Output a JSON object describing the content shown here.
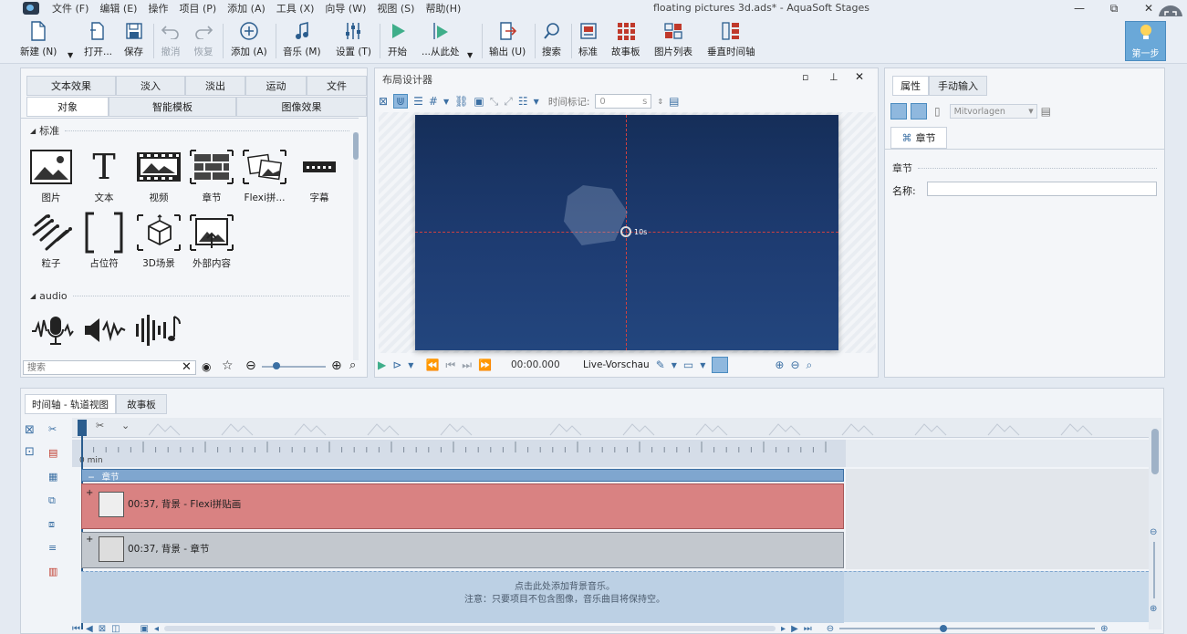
{
  "window": {
    "title": "floating pictures 3d.ads* - AquaSoft Stages",
    "min": "—",
    "restore": "⧉",
    "close": "✕"
  },
  "menu": [
    "文件 (F)",
    "编辑 (E)",
    "操作",
    "项目 (P)",
    "添加 (A)",
    "工具 (X)",
    "向导 (W)",
    "视图 (S)",
    "帮助(H)"
  ],
  "toolbar": {
    "new": "新建 (N)",
    "open": "打开...",
    "save": "保存",
    "undo": "撤消",
    "redo": "恢复",
    "add": "添加 (A)",
    "music": "音乐 (M)",
    "settings": "设置 (T)",
    "start": "开始",
    "from_here": "...从此处",
    "export": "输出 (U)",
    "search": "搜索",
    "standard": "标准",
    "storyboard": "故事板",
    "image_list": "图片列表",
    "vertical_timeline": "垂直时间轴",
    "first_step": "第一步"
  },
  "left_panel": {
    "tabs_row1": [
      "文本效果",
      "淡入",
      "淡出",
      "运动",
      "文件"
    ],
    "tabs_row2": [
      "对象",
      "智能模板",
      "图像效果"
    ],
    "section_standard": "标准",
    "section_audio": "audio",
    "objects": [
      "图片",
      "文本",
      "视频",
      "章节",
      "Flexi拼...",
      "字幕",
      "粒子",
      "占位符",
      "3D场景",
      "外部内容"
    ],
    "search_placeholder": "搜索"
  },
  "designer": {
    "title": "布局设计器",
    "time_marker_label": "时间标记:",
    "time_marker_value": "0",
    "time_unit": "s",
    "time_display": "00:00.000",
    "live_preview": "Live-Vorschau",
    "stage_label": "10s"
  },
  "properties": {
    "tabs": [
      "属性",
      "手动输入"
    ],
    "templates": "Mitvorlagen",
    "subtab": "章节",
    "section": "章节",
    "name_label": "名称:",
    "name_value": ""
  },
  "timeline": {
    "tabs": [
      "时间轴 - 轨道视图",
      "故事板"
    ],
    "ruler_start": "0 min",
    "chapter_label": "章节",
    "track1_label": "00:37, 背景 - Flexi拼贴画",
    "track2_label": "00:37, 背景 - 章节",
    "music_hint_line1": "点击此处添加背景音乐。",
    "music_hint_line2": "注意：只要项目不包含图像，音乐曲目将保持空。"
  },
  "colors": {
    "accent": "#4b8cc0",
    "stage_top": "#152e59",
    "track_red": "#d98282",
    "track_gray": "#c3c8ce",
    "music_bg": "#c9daea"
  }
}
